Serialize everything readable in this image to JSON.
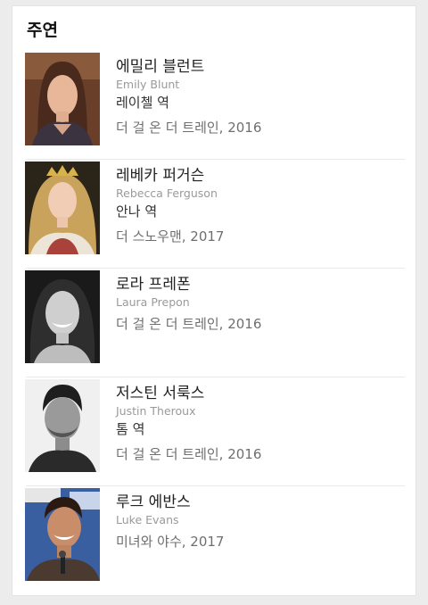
{
  "section": {
    "title": "주연"
  },
  "cast": [
    {
      "name_ko": "에밀리 블런트",
      "name_en": "Emily Blunt",
      "role": "레이첼 역",
      "work": "더 걸 온 더 트레인, 2016"
    },
    {
      "name_ko": "레베카 퍼거슨",
      "name_en": "Rebecca Ferguson",
      "role": "안나 역",
      "work": "더 스노우맨, 2017"
    },
    {
      "name_ko": "로라 프레폰",
      "name_en": "Laura Prepon",
      "role": "",
      "work": "더 걸 온 더 트레인, 2016"
    },
    {
      "name_ko": "저스틴 서룩스",
      "name_en": "Justin Theroux",
      "role": "톰 역",
      "work": "더 걸 온 더 트레인, 2016"
    },
    {
      "name_ko": "루크 에반스",
      "name_en": "Luke Evans",
      "role": "",
      "work": "미녀와 야수, 2017"
    }
  ]
}
